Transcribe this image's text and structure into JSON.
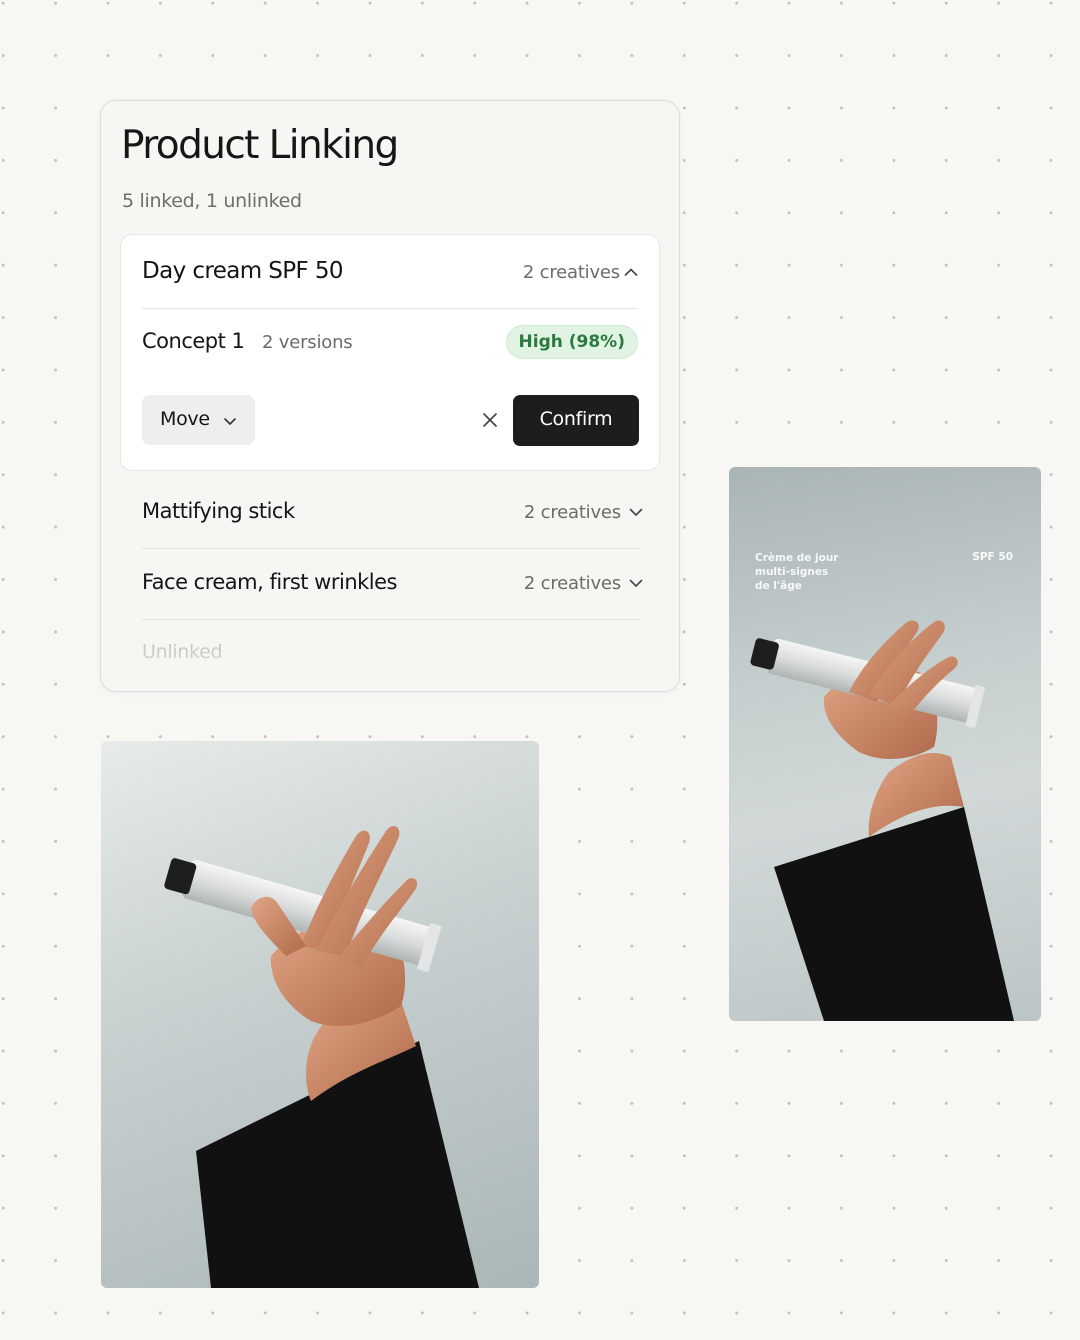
{
  "panel": {
    "title": "Product Linking",
    "summary": "5 linked, 1 unlinked"
  },
  "expanded_group": {
    "name": "Day cream SPF 50",
    "count": "2 creatives",
    "concept": {
      "name": "Concept 1",
      "versions": "2 versions",
      "match_badge": "High (98%)",
      "match_confidence": 0.98
    },
    "move_label": "Move",
    "confirm_label": "Confirm"
  },
  "groups": [
    {
      "name": "Mattifying stick",
      "count": "2 creatives"
    },
    {
      "name": "Face cream, first wrinkles",
      "count": "2 creatives"
    }
  ],
  "unlinked_label": "Unlinked",
  "creatives": {
    "story_headline_lines": [
      "Crème de jour",
      "multi-signes",
      "de l'âge"
    ],
    "story_badge": "SPF 50"
  },
  "colors": {
    "badge_bg": "#e1f4e4",
    "badge_text": "#2b7a3d",
    "confirm_bg": "#1d1d1d",
    "background": "#f8f7f4"
  },
  "icons": {
    "group_toggle_expanded": "chevron-up-icon",
    "group_toggle_collapsed": "chevron-down-icon",
    "dismiss": "close-icon"
  }
}
